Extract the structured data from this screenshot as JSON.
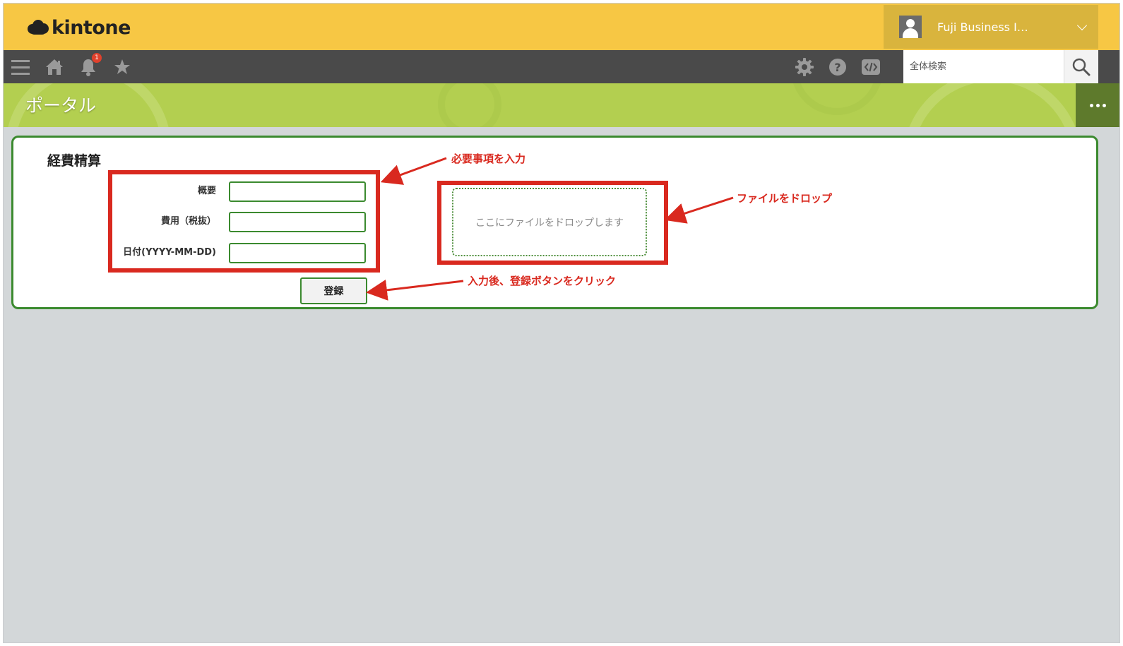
{
  "app": {
    "logo_text": "kintone",
    "user_name": "Fuji Business I…"
  },
  "nav": {
    "notification_count": "1",
    "search_placeholder": "全体検索"
  },
  "banner": {
    "title": "ポータル"
  },
  "form": {
    "title": "経費精算",
    "fields": [
      {
        "label": "概要",
        "value": ""
      },
      {
        "label": "費用（税抜）",
        "value": ""
      },
      {
        "label": "日付(YYYY-MM-DD)",
        "value": ""
      }
    ],
    "dropzone_text": "ここにファイルをドロップします",
    "submit_label": "登録"
  },
  "annotations": {
    "input_note": "必要事項を入力",
    "drop_note": "ファイルをドロップ",
    "submit_note": "入力後、登録ボタンをクリック"
  },
  "colors": {
    "topbar": "#f7c744",
    "navbar": "#4a4a4a",
    "banner": "#b3cf50",
    "form_border": "#3b8a2f",
    "annotation": "#d9291f"
  }
}
